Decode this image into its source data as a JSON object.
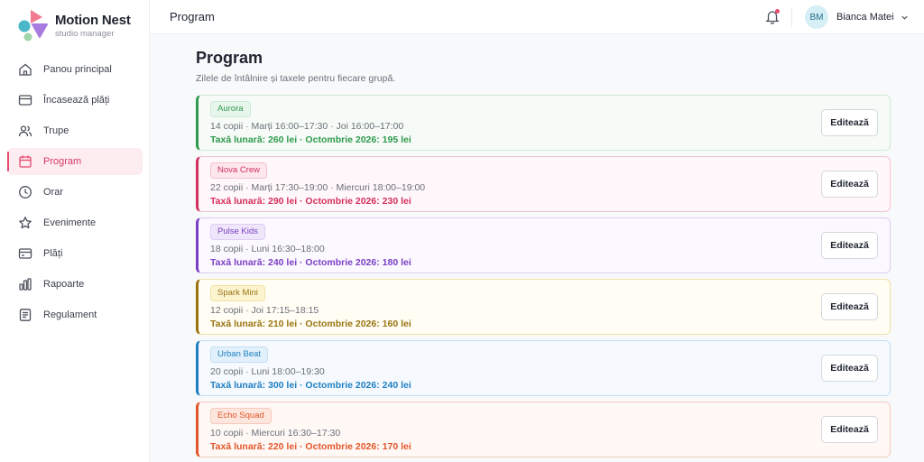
{
  "brand": {
    "name": "Motion Nest",
    "subtitle": "studio manager"
  },
  "sidebar": {
    "items": [
      {
        "label": "Panou principal",
        "icon": "home-icon",
        "active": false
      },
      {
        "label": "Încasează plăți",
        "icon": "card-icon",
        "active": false
      },
      {
        "label": "Trupe",
        "icon": "users-icon",
        "active": false
      },
      {
        "label": "Program",
        "icon": "calendar-icon",
        "active": true
      },
      {
        "label": "Orar",
        "icon": "clock-icon",
        "active": false
      },
      {
        "label": "Evenimente",
        "icon": "star-icon",
        "active": false
      },
      {
        "label": "Plăți",
        "icon": "wallet-icon",
        "active": false
      },
      {
        "label": "Rapoarte",
        "icon": "bar-chart-icon",
        "active": false
      },
      {
        "label": "Regulament",
        "icon": "document-icon",
        "active": false
      }
    ]
  },
  "header": {
    "title": "Program",
    "notifications_icon": "bell-icon",
    "user": {
      "initials": "BM",
      "name": "Bianca Matei"
    }
  },
  "main": {
    "title": "Program",
    "subtitle": "Zilele de întâlnire și taxele pentru fiecare grupă.",
    "edit_label": "Editează",
    "groups": [
      {
        "name": "Aurora",
        "details": "14 copii · Marți 16:00–17:30 · Joi 16:00–17:00",
        "fee": "Taxă lunară: 260 lei · Octombrie 2026: 195 lei",
        "color": "#2f9a4e",
        "tint": "#f6fbf7",
        "tag_bg": "#e6f6ea",
        "border": "#cfe9d6"
      },
      {
        "name": "Nova Crew",
        "details": "22 copii · Marți 17:30–19:00 · Miercuri 18:00–19:00",
        "fee": "Taxă lunară: 290 lei · Octombrie 2026: 230 lei",
        "color": "#d4305f",
        "tint": "#fff7f9",
        "tag_bg": "#fde6ec",
        "border": "#f2c3d0"
      },
      {
        "name": "Pulse Kids",
        "details": "18 copii · Luni 16:30–18:00",
        "fee": "Taxă lunară: 240 lei · Octombrie 2026: 180 lei",
        "color": "#7a3fc4",
        "tint": "#fbf8ff",
        "tag_bg": "#efe6fb",
        "border": "#ddcdf3"
      },
      {
        "name": "Spark Mini",
        "details": "12 copii · Joi 17:15–18:15",
        "fee": "Taxă lunară: 210 lei · Octombrie 2026: 160 lei",
        "color": "#9a7412",
        "tint": "#fffdf4",
        "tag_bg": "#fcf3cf",
        "border": "#f1e2a6"
      },
      {
        "name": "Urban Beat",
        "details": "20 copii · Luni 18:00–19:30",
        "fee": "Taxă lunară: 300 lei · Octombrie 2026: 240 lei",
        "color": "#1f7fc2",
        "tint": "#f6fafe",
        "tag_bg": "#e1f0fb",
        "border": "#c5dff2"
      },
      {
        "name": "Echo Squad",
        "details": "10 copii · Miercuri 16:30–17:30",
        "fee": "Taxă lunară: 220 lei · Octombrie 2026: 170 lei",
        "color": "#e2562b",
        "tint": "#fff8f5",
        "tag_bg": "#fde6dd",
        "border": "#f5cbbd"
      }
    ]
  }
}
